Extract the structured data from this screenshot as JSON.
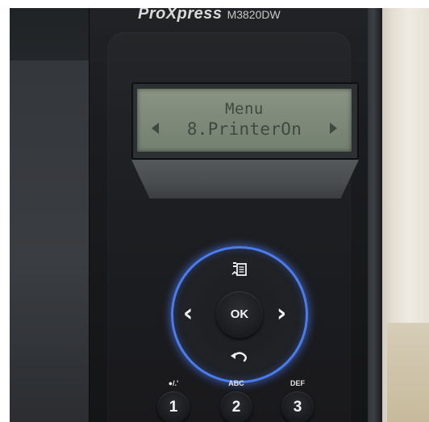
{
  "printer": {
    "brand": "ProXpress",
    "model": "M3820DW"
  },
  "lcd": {
    "line1": "Menu",
    "line2": "8.PrinterOn"
  },
  "nav": {
    "ok_label": "OK",
    "left_glyph": "‹",
    "right_glyph": "›"
  },
  "keypad": [
    {
      "sub": "●/.'",
      "digit": "1"
    },
    {
      "sub": "ABC",
      "digit": "2"
    },
    {
      "sub": "DEF",
      "digit": "3"
    }
  ],
  "colors": {
    "ring_glow": "#4a7cf0",
    "lcd_background": "#7e897a",
    "lcd_text": "#3e4a3f"
  },
  "icons": {
    "menu": "menu-icon",
    "back": "back-icon"
  }
}
